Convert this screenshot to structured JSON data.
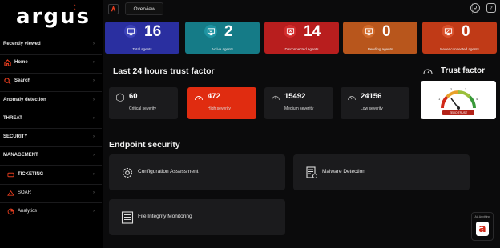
{
  "brand": {
    "logo_text": "argus",
    "accent": "#e23c1e"
  },
  "sidebar": {
    "items": [
      {
        "label": "Recently viewed",
        "icon": "",
        "bold": true
      },
      {
        "label": "Home",
        "icon": "home-icon"
      },
      {
        "label": "Search",
        "icon": "search-icon"
      },
      {
        "label": "Anomaly detection",
        "icon": ""
      },
      {
        "label": "THREAT",
        "icon": ""
      },
      {
        "label": "SECURITY",
        "icon": ""
      },
      {
        "label": "MANAGEMENT",
        "icon": ""
      },
      {
        "label": "TICKETING",
        "icon": "ticket-icon"
      },
      {
        "label": "SOAR",
        "icon": "soar-icon"
      },
      {
        "label": "Analytics",
        "icon": "analytics-icon"
      }
    ]
  },
  "topbar": {
    "tab_label": "Overview"
  },
  "agent_cards": [
    {
      "value": "16",
      "label": "Total agents",
      "color": "#2a2fa0"
    },
    {
      "value": "2",
      "label": "Active agents",
      "color": "#157b87"
    },
    {
      "value": "14",
      "label": "Disconnected agents",
      "color": "#b81e1e"
    },
    {
      "value": "0",
      "label": "Pending agents",
      "color": "#b8561c"
    },
    {
      "value": "0",
      "label": "Never connected agents",
      "color": "#c03a17"
    }
  ],
  "trust": {
    "title": "Last 24 hours trust factor",
    "panel_title": "Trust factor",
    "badge": "ZERO TRUST",
    "severities": [
      {
        "value": "60",
        "label": "Critical severity",
        "highlight": false
      },
      {
        "value": "472",
        "label": "High severity",
        "highlight": true
      },
      {
        "value": "15492",
        "label": "Medium severity",
        "highlight": false
      },
      {
        "value": "24156",
        "label": "Low severity",
        "highlight": false
      }
    ],
    "gauge_ticks": [
      "1",
      "2",
      "3",
      "4"
    ]
  },
  "endpoint": {
    "title": "Endpoint security",
    "items": [
      {
        "label": "Configuration Assessment",
        "icon": "gear-icon"
      },
      {
        "label": "Malware Detection",
        "icon": "malware-doc-icon"
      },
      {
        "label": "File Integrity Monitoring",
        "icon": "file-list-icon"
      }
    ]
  },
  "assistant": {
    "label": "AA Anything",
    "letter": "a"
  }
}
